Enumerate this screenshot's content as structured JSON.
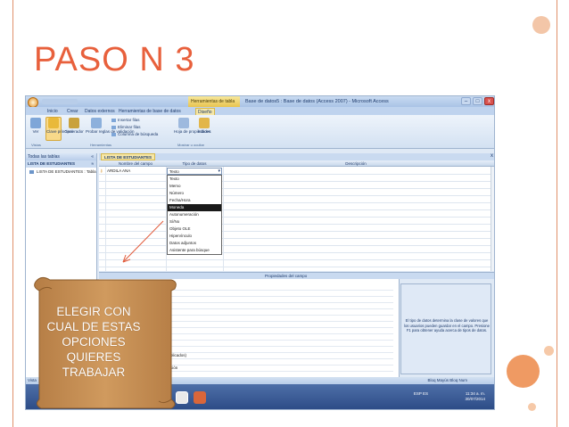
{
  "slide": {
    "title": "PASO N 3",
    "callout_lines": [
      "ELEGIR CON",
      "CUAL DE ESTAS",
      "OPCIONES",
      "QUIERES",
      "TRABAJAR"
    ]
  },
  "window": {
    "context_tab": "Herramientas de tabla",
    "title": "Base de datos5 : Base de datos (Access 2007) - Microsoft Access",
    "min": "–",
    "max": "□",
    "close": "x"
  },
  "ribbon_tabs": [
    "Inicio",
    "Crear",
    "Datos externos",
    "Herramientas de base de datos",
    "Diseño"
  ],
  "ribbon": {
    "ver_label": "Ver",
    "clave_label": "Clave principal",
    "generador_label": "Generador",
    "probar_label": "Probar reglas de validación",
    "insertar_filas": "Insertar filas",
    "eliminar_filas": "Eliminar filas",
    "columna_busqueda": "Columna de búsqueda",
    "hoja_label": "Hoja de propiedades",
    "indices_label": "Índices",
    "group_vistas": "Vistas",
    "group_herramientas": "Herramientas",
    "group_mostrar": "Mostrar u ocultar"
  },
  "nav": {
    "header": "Todas las tablas",
    "arrows": "«",
    "group": "LISTA DE ESTUDIANTES",
    "group_chevron": "≈",
    "item": "LISTA DE ESTUDIANTES : Tabla"
  },
  "doc_tab": {
    "label": "LISTA DE ESTUDIANTES",
    "close": "x"
  },
  "grid": {
    "headers": [
      "Nombre del campo",
      "Tipo de datos",
      "Descripción"
    ],
    "row1_field": "ARDILA ANA",
    "row1_type": "Texto"
  },
  "dropdown_options": [
    "Texto",
    "Memo",
    "Número",
    "Fecha/Hora",
    "Moneda",
    "Autonumeración",
    "Sí/No",
    "Objeto OLE",
    "Hipervínculo",
    "Datos adjuntos",
    "Asistente para búsque"
  ],
  "dropdown_selected": "Moneda",
  "properties": {
    "bar_label": "Propiedades del campo",
    "row_a": "plicados)",
    "row_b": "ción",
    "help_text": "El tipo de datos determina la clase de valores que los usuarios pueden guardar en el campo. Presione F1 para obtener ayuda acerca de tipos de datos."
  },
  "status": {
    "left": "Vista",
    "right": "Bloq Mayús   Bloq Num"
  },
  "taskbar": {
    "lang": "ESP\nES",
    "time": "11:34 a. m.",
    "date": "30/07/2014"
  },
  "colors": {
    "title": "#e8603c",
    "frame": "#e0906a",
    "scroll_fill": "#c38a4e",
    "accent_circle": "#ef9a63"
  }
}
